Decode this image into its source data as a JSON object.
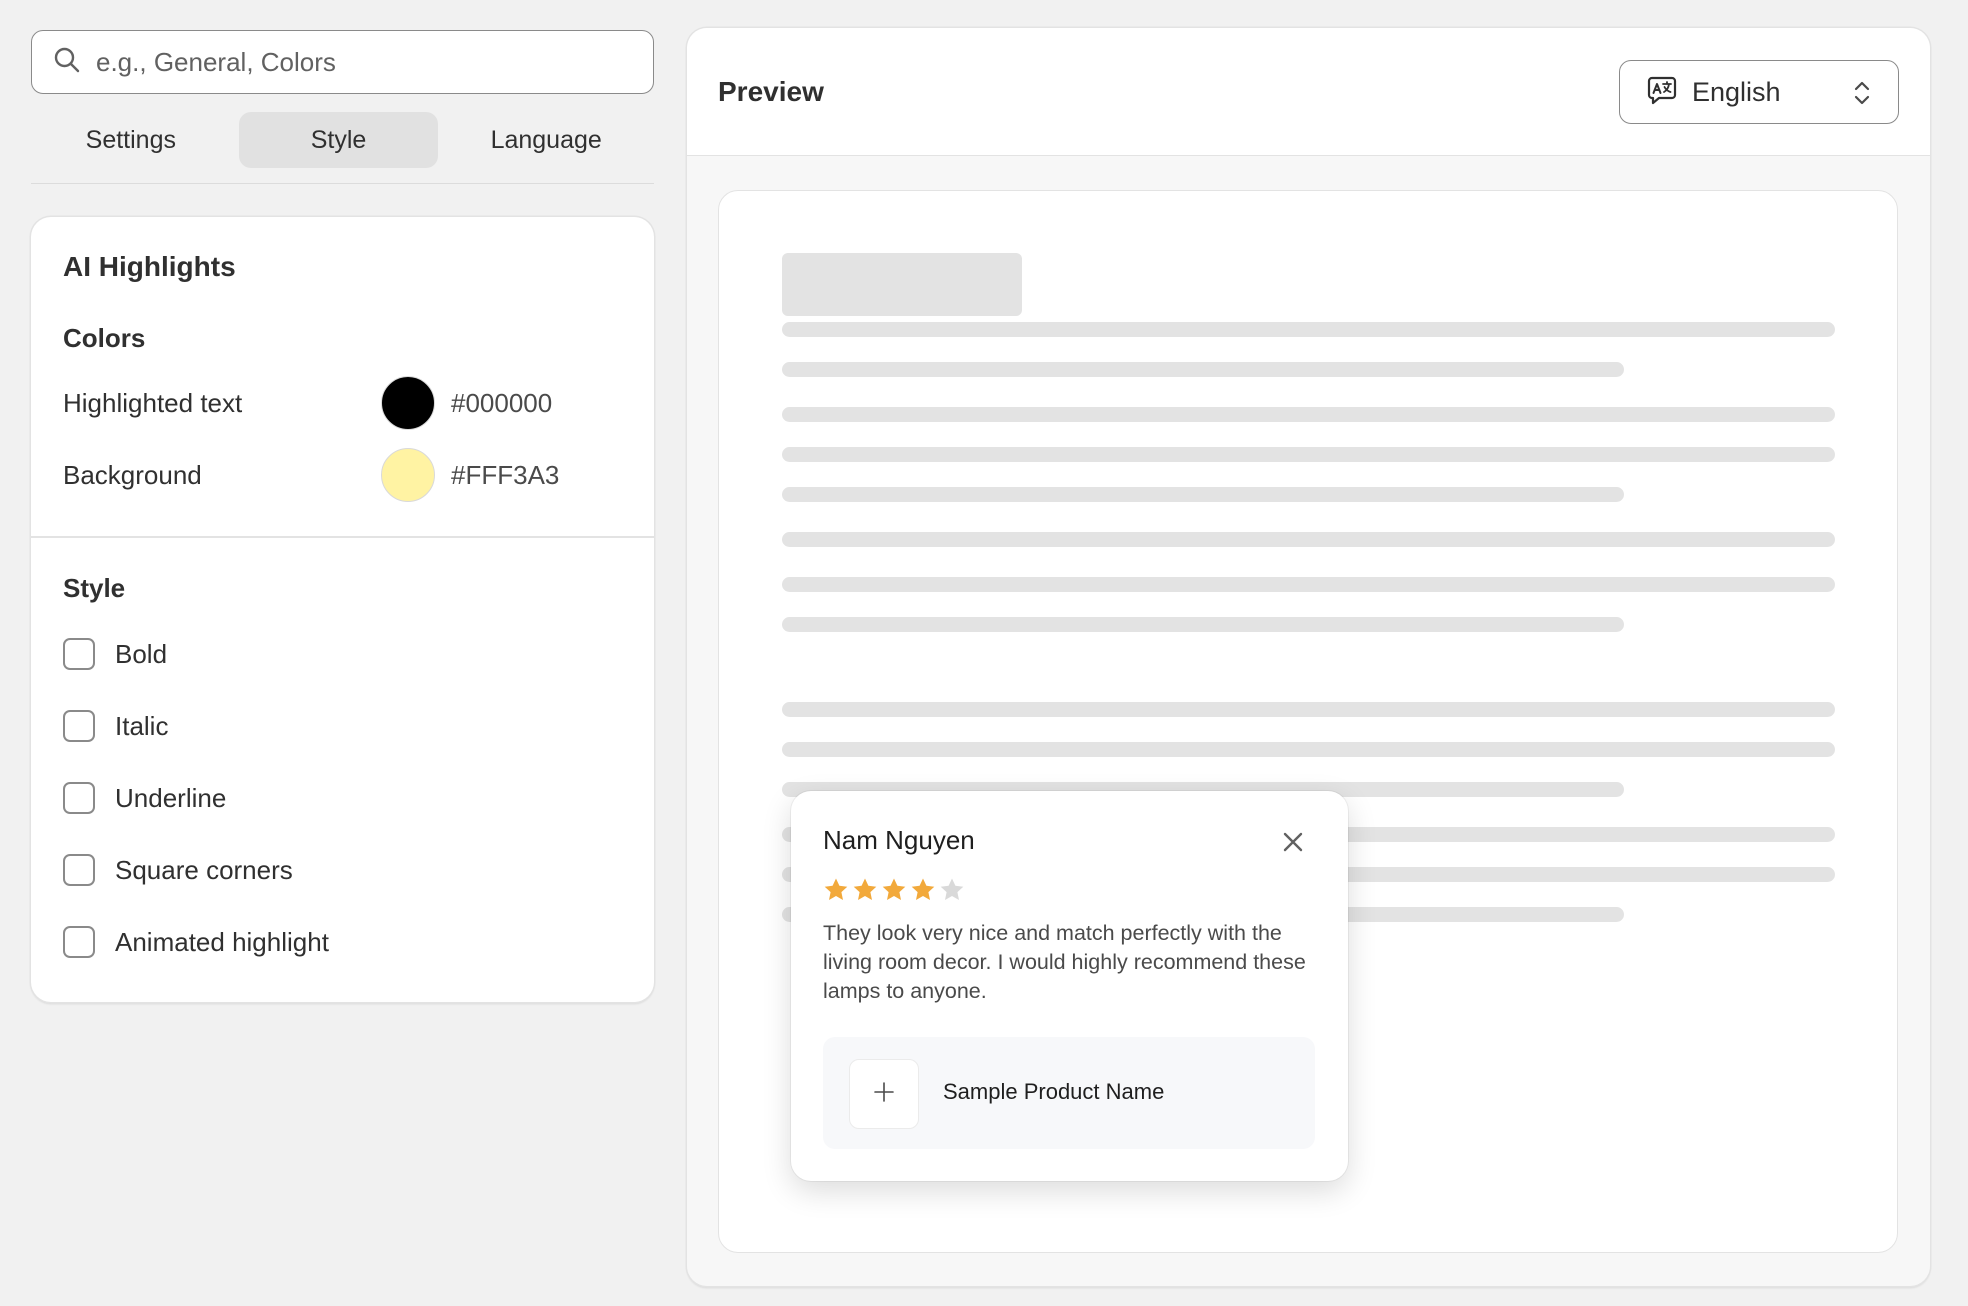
{
  "search": {
    "placeholder": "e.g., General, Colors",
    "value": ""
  },
  "tabs": [
    {
      "label": "Settings",
      "active": false
    },
    {
      "label": "Style",
      "active": true
    },
    {
      "label": "Language",
      "active": false
    }
  ],
  "highlights": {
    "title": "AI Highlights",
    "colors_heading": "Colors",
    "colors": [
      {
        "label": "Highlighted text",
        "hex": "#000000"
      },
      {
        "label": "Background",
        "hex": "#FFF3A3"
      }
    ],
    "style_heading": "Style",
    "options": [
      {
        "label": "Bold",
        "checked": false
      },
      {
        "label": "Italic",
        "checked": false
      },
      {
        "label": "Underline",
        "checked": false
      },
      {
        "label": "Square corners",
        "checked": false
      },
      {
        "label": "Animated highlight",
        "checked": false
      }
    ]
  },
  "preview": {
    "title": "Preview",
    "language": "English",
    "popup": {
      "reviewer": "Nam Nguyen",
      "rating": 4,
      "max_rating": 5,
      "review": "They look very nice and match perfectly with the living room decor. I would highly recommend these lamps to anyone.",
      "product_name": "Sample Product Name"
    }
  },
  "colors": {
    "star_filled": "#F2A93B",
    "star_empty": "#D9D9D9",
    "skeleton": "#E3E3E3"
  },
  "icons": {
    "search": "search-icon",
    "language": "translate-icon",
    "select": "chevron-up-down-icon",
    "close": "close-icon",
    "product_placeholder": "plus-icon"
  }
}
